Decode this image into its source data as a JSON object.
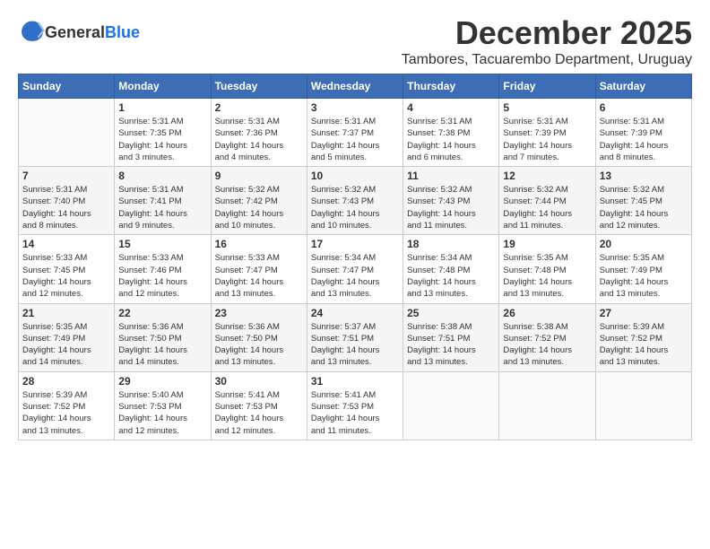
{
  "logo": {
    "text_general": "General",
    "text_blue": "Blue"
  },
  "header": {
    "month": "December 2025",
    "location": "Tambores, Tacuarembo Department, Uruguay"
  },
  "weekdays": [
    "Sunday",
    "Monday",
    "Tuesday",
    "Wednesday",
    "Thursday",
    "Friday",
    "Saturday"
  ],
  "weeks": [
    [
      {
        "day": "",
        "info": ""
      },
      {
        "day": "1",
        "info": "Sunrise: 5:31 AM\nSunset: 7:35 PM\nDaylight: 14 hours\nand 3 minutes."
      },
      {
        "day": "2",
        "info": "Sunrise: 5:31 AM\nSunset: 7:36 PM\nDaylight: 14 hours\nand 4 minutes."
      },
      {
        "day": "3",
        "info": "Sunrise: 5:31 AM\nSunset: 7:37 PM\nDaylight: 14 hours\nand 5 minutes."
      },
      {
        "day": "4",
        "info": "Sunrise: 5:31 AM\nSunset: 7:38 PM\nDaylight: 14 hours\nand 6 minutes."
      },
      {
        "day": "5",
        "info": "Sunrise: 5:31 AM\nSunset: 7:39 PM\nDaylight: 14 hours\nand 7 minutes."
      },
      {
        "day": "6",
        "info": "Sunrise: 5:31 AM\nSunset: 7:39 PM\nDaylight: 14 hours\nand 8 minutes."
      }
    ],
    [
      {
        "day": "7",
        "info": "Sunrise: 5:31 AM\nSunset: 7:40 PM\nDaylight: 14 hours\nand 8 minutes."
      },
      {
        "day": "8",
        "info": "Sunrise: 5:31 AM\nSunset: 7:41 PM\nDaylight: 14 hours\nand 9 minutes."
      },
      {
        "day": "9",
        "info": "Sunrise: 5:32 AM\nSunset: 7:42 PM\nDaylight: 14 hours\nand 10 minutes."
      },
      {
        "day": "10",
        "info": "Sunrise: 5:32 AM\nSunset: 7:43 PM\nDaylight: 14 hours\nand 10 minutes."
      },
      {
        "day": "11",
        "info": "Sunrise: 5:32 AM\nSunset: 7:43 PM\nDaylight: 14 hours\nand 11 minutes."
      },
      {
        "day": "12",
        "info": "Sunrise: 5:32 AM\nSunset: 7:44 PM\nDaylight: 14 hours\nand 11 minutes."
      },
      {
        "day": "13",
        "info": "Sunrise: 5:32 AM\nSunset: 7:45 PM\nDaylight: 14 hours\nand 12 minutes."
      }
    ],
    [
      {
        "day": "14",
        "info": "Sunrise: 5:33 AM\nSunset: 7:45 PM\nDaylight: 14 hours\nand 12 minutes."
      },
      {
        "day": "15",
        "info": "Sunrise: 5:33 AM\nSunset: 7:46 PM\nDaylight: 14 hours\nand 12 minutes."
      },
      {
        "day": "16",
        "info": "Sunrise: 5:33 AM\nSunset: 7:47 PM\nDaylight: 14 hours\nand 13 minutes."
      },
      {
        "day": "17",
        "info": "Sunrise: 5:34 AM\nSunset: 7:47 PM\nDaylight: 14 hours\nand 13 minutes."
      },
      {
        "day": "18",
        "info": "Sunrise: 5:34 AM\nSunset: 7:48 PM\nDaylight: 14 hours\nand 13 minutes."
      },
      {
        "day": "19",
        "info": "Sunrise: 5:35 AM\nSunset: 7:48 PM\nDaylight: 14 hours\nand 13 minutes."
      },
      {
        "day": "20",
        "info": "Sunrise: 5:35 AM\nSunset: 7:49 PM\nDaylight: 14 hours\nand 13 minutes."
      }
    ],
    [
      {
        "day": "21",
        "info": "Sunrise: 5:35 AM\nSunset: 7:49 PM\nDaylight: 14 hours\nand 14 minutes."
      },
      {
        "day": "22",
        "info": "Sunrise: 5:36 AM\nSunset: 7:50 PM\nDaylight: 14 hours\nand 14 minutes."
      },
      {
        "day": "23",
        "info": "Sunrise: 5:36 AM\nSunset: 7:50 PM\nDaylight: 14 hours\nand 13 minutes."
      },
      {
        "day": "24",
        "info": "Sunrise: 5:37 AM\nSunset: 7:51 PM\nDaylight: 14 hours\nand 13 minutes."
      },
      {
        "day": "25",
        "info": "Sunrise: 5:38 AM\nSunset: 7:51 PM\nDaylight: 14 hours\nand 13 minutes."
      },
      {
        "day": "26",
        "info": "Sunrise: 5:38 AM\nSunset: 7:52 PM\nDaylight: 14 hours\nand 13 minutes."
      },
      {
        "day": "27",
        "info": "Sunrise: 5:39 AM\nSunset: 7:52 PM\nDaylight: 14 hours\nand 13 minutes."
      }
    ],
    [
      {
        "day": "28",
        "info": "Sunrise: 5:39 AM\nSunset: 7:52 PM\nDaylight: 14 hours\nand 13 minutes."
      },
      {
        "day": "29",
        "info": "Sunrise: 5:40 AM\nSunset: 7:53 PM\nDaylight: 14 hours\nand 12 minutes."
      },
      {
        "day": "30",
        "info": "Sunrise: 5:41 AM\nSunset: 7:53 PM\nDaylight: 14 hours\nand 12 minutes."
      },
      {
        "day": "31",
        "info": "Sunrise: 5:41 AM\nSunset: 7:53 PM\nDaylight: 14 hours\nand 11 minutes."
      },
      {
        "day": "",
        "info": ""
      },
      {
        "day": "",
        "info": ""
      },
      {
        "day": "",
        "info": ""
      }
    ]
  ]
}
